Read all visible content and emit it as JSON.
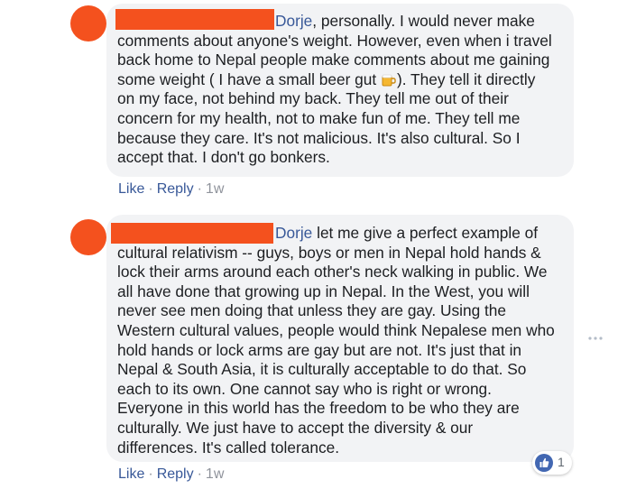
{
  "comments": [
    {
      "mention": "Dorje",
      "lines": [
        ", personally. I would never make",
        "comments about anyone's weight. However, even when i travel",
        "back home to Nepal people make comments about me gaining",
        "some weight ( I have a small beer gut",
        "). They tell it directly",
        "on my face, not behind my back. They tell me out of their",
        "concern for my health, not to make fun of me. They tell me",
        "because they care. It's not malicious. It's also cultural. So I",
        "accept that. I don't go bonkers."
      ],
      "actions": {
        "like": "Like",
        "reply": "Reply",
        "time": "1w"
      }
    },
    {
      "mention": "Dorje",
      "lines": [
        " let me give a perfect example of",
        "cultural relativism -- guys, boys or men in Nepal hold hands &",
        "lock their arms around each other's neck walking in public. We",
        "all have done that growing up in Nepal. In the West, you will",
        "never see men doing that unless they are gay. Using the",
        "Western cultural values, people would think Nepalese men who",
        "hold hands or lock arms are gay but are not. It's just that in",
        "Nepal & South Asia, it is culturally acceptable to do that. So",
        "each to its own. One cannot say who is right or wrong.",
        "Everyone in this world has the freedom to be who they are",
        "culturally. We just have to accept the diversity & our",
        "differences. It's called tolerance."
      ],
      "actions": {
        "like": "Like",
        "reply": "Reply",
        "time": "1w"
      },
      "reaction_count": "1"
    }
  ],
  "icons": {
    "emoji": "beer-mug-icon",
    "more": "more-options-icon",
    "reaction": "like-reaction-icon"
  },
  "colors": {
    "redaction": "#f4511e",
    "bubble": "#f2f3f5",
    "link": "#385898",
    "like_blue": "#4267b2"
  }
}
